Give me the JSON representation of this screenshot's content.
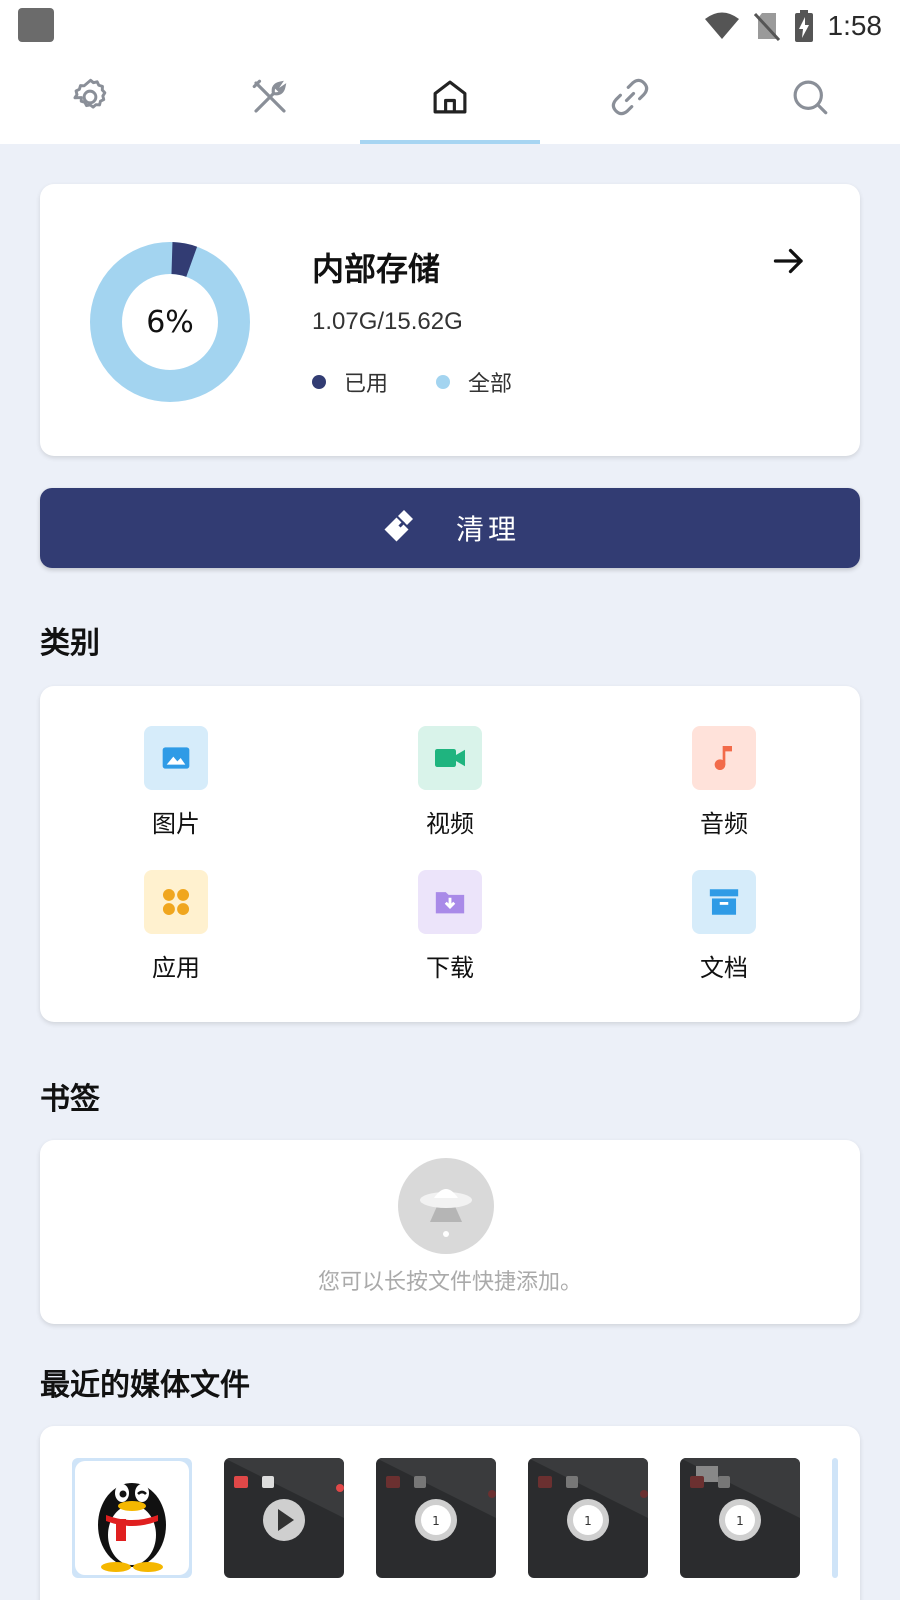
{
  "status_bar": {
    "time": "1:58",
    "icons": [
      "app-placeholder-icon",
      "wifi-icon",
      "no-sim-icon",
      "battery-charging-icon"
    ]
  },
  "tabs": [
    {
      "name": "settings",
      "icon": "gear-icon",
      "active": false
    },
    {
      "name": "tools",
      "icon": "tools-icon",
      "active": false
    },
    {
      "name": "home",
      "icon": "home-icon",
      "active": true
    },
    {
      "name": "link",
      "icon": "link-icon",
      "active": false
    },
    {
      "name": "search",
      "icon": "search-icon",
      "active": false
    }
  ],
  "storage": {
    "title": "内部存储",
    "size_text": "1.07G/15.62G",
    "percent_text": "6%",
    "used_fraction": 0.06,
    "legend_used": "已用",
    "legend_total": "全部",
    "colors": {
      "used": "#323C73",
      "total": "#A3D4F0"
    }
  },
  "clean_button": {
    "label": "清理"
  },
  "categories": {
    "title": "类别",
    "items": [
      {
        "label": "图片",
        "icon": "image-icon",
        "bg": "#D6ECFA",
        "fg": "#2F9BE6"
      },
      {
        "label": "视频",
        "icon": "video-icon",
        "bg": "#D9F3EA",
        "fg": "#1FB47F"
      },
      {
        "label": "音频",
        "icon": "music-icon",
        "bg": "#FFE2DA",
        "fg": "#F26B4A"
      },
      {
        "label": "应用",
        "icon": "apps-icon",
        "bg": "#FFF1CF",
        "fg": "#F0A61E"
      },
      {
        "label": "下载",
        "icon": "download-folder-icon",
        "bg": "#ECE4FA",
        "fg": "#A98AE8"
      },
      {
        "label": "文档",
        "icon": "archive-icon",
        "bg": "#D6ECFA",
        "fg": "#2F9BE6"
      }
    ]
  },
  "bookmarks": {
    "title": "书签",
    "empty_text": "您可以长按文件快捷添加。"
  },
  "recent_media": {
    "title": "最近的媒体文件",
    "thumbnails": [
      "qq-penguin-thumbnail",
      "video-play-thumbnail",
      "screenshot-thumbnail",
      "screenshot-thumbnail",
      "screenshot-thumbnail"
    ]
  }
}
